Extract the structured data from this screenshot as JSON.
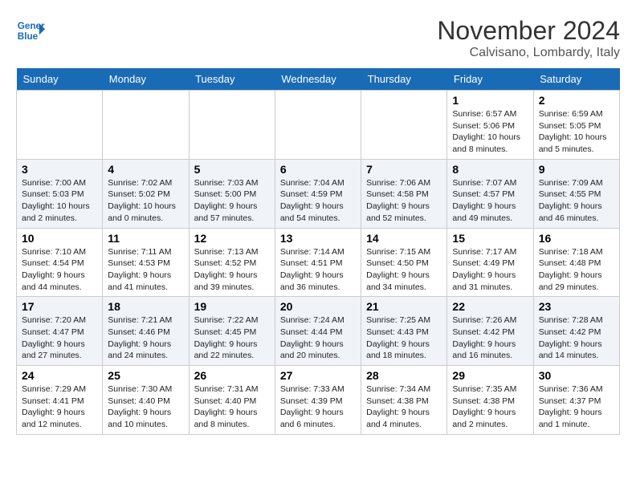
{
  "header": {
    "logo_line1": "General",
    "logo_line2": "Blue",
    "month": "November 2024",
    "location": "Calvisano, Lombardy, Italy"
  },
  "weekdays": [
    "Sunday",
    "Monday",
    "Tuesday",
    "Wednesday",
    "Thursday",
    "Friday",
    "Saturday"
  ],
  "weeks": [
    [
      {
        "day": "",
        "info": ""
      },
      {
        "day": "",
        "info": ""
      },
      {
        "day": "",
        "info": ""
      },
      {
        "day": "",
        "info": ""
      },
      {
        "day": "",
        "info": ""
      },
      {
        "day": "1",
        "info": "Sunrise: 6:57 AM\nSunset: 5:06 PM\nDaylight: 10 hours\nand 8 minutes."
      },
      {
        "day": "2",
        "info": "Sunrise: 6:59 AM\nSunset: 5:05 PM\nDaylight: 10 hours\nand 5 minutes."
      }
    ],
    [
      {
        "day": "3",
        "info": "Sunrise: 7:00 AM\nSunset: 5:03 PM\nDaylight: 10 hours\nand 2 minutes."
      },
      {
        "day": "4",
        "info": "Sunrise: 7:02 AM\nSunset: 5:02 PM\nDaylight: 10 hours\nand 0 minutes."
      },
      {
        "day": "5",
        "info": "Sunrise: 7:03 AM\nSunset: 5:00 PM\nDaylight: 9 hours\nand 57 minutes."
      },
      {
        "day": "6",
        "info": "Sunrise: 7:04 AM\nSunset: 4:59 PM\nDaylight: 9 hours\nand 54 minutes."
      },
      {
        "day": "7",
        "info": "Sunrise: 7:06 AM\nSunset: 4:58 PM\nDaylight: 9 hours\nand 52 minutes."
      },
      {
        "day": "8",
        "info": "Sunrise: 7:07 AM\nSunset: 4:57 PM\nDaylight: 9 hours\nand 49 minutes."
      },
      {
        "day": "9",
        "info": "Sunrise: 7:09 AM\nSunset: 4:55 PM\nDaylight: 9 hours\nand 46 minutes."
      }
    ],
    [
      {
        "day": "10",
        "info": "Sunrise: 7:10 AM\nSunset: 4:54 PM\nDaylight: 9 hours\nand 44 minutes."
      },
      {
        "day": "11",
        "info": "Sunrise: 7:11 AM\nSunset: 4:53 PM\nDaylight: 9 hours\nand 41 minutes."
      },
      {
        "day": "12",
        "info": "Sunrise: 7:13 AM\nSunset: 4:52 PM\nDaylight: 9 hours\nand 39 minutes."
      },
      {
        "day": "13",
        "info": "Sunrise: 7:14 AM\nSunset: 4:51 PM\nDaylight: 9 hours\nand 36 minutes."
      },
      {
        "day": "14",
        "info": "Sunrise: 7:15 AM\nSunset: 4:50 PM\nDaylight: 9 hours\nand 34 minutes."
      },
      {
        "day": "15",
        "info": "Sunrise: 7:17 AM\nSunset: 4:49 PM\nDaylight: 9 hours\nand 31 minutes."
      },
      {
        "day": "16",
        "info": "Sunrise: 7:18 AM\nSunset: 4:48 PM\nDaylight: 9 hours\nand 29 minutes."
      }
    ],
    [
      {
        "day": "17",
        "info": "Sunrise: 7:20 AM\nSunset: 4:47 PM\nDaylight: 9 hours\nand 27 minutes."
      },
      {
        "day": "18",
        "info": "Sunrise: 7:21 AM\nSunset: 4:46 PM\nDaylight: 9 hours\nand 24 minutes."
      },
      {
        "day": "19",
        "info": "Sunrise: 7:22 AM\nSunset: 4:45 PM\nDaylight: 9 hours\nand 22 minutes."
      },
      {
        "day": "20",
        "info": "Sunrise: 7:24 AM\nSunset: 4:44 PM\nDaylight: 9 hours\nand 20 minutes."
      },
      {
        "day": "21",
        "info": "Sunrise: 7:25 AM\nSunset: 4:43 PM\nDaylight: 9 hours\nand 18 minutes."
      },
      {
        "day": "22",
        "info": "Sunrise: 7:26 AM\nSunset: 4:42 PM\nDaylight: 9 hours\nand 16 minutes."
      },
      {
        "day": "23",
        "info": "Sunrise: 7:28 AM\nSunset: 4:42 PM\nDaylight: 9 hours\nand 14 minutes."
      }
    ],
    [
      {
        "day": "24",
        "info": "Sunrise: 7:29 AM\nSunset: 4:41 PM\nDaylight: 9 hours\nand 12 minutes."
      },
      {
        "day": "25",
        "info": "Sunrise: 7:30 AM\nSunset: 4:40 PM\nDaylight: 9 hours\nand 10 minutes."
      },
      {
        "day": "26",
        "info": "Sunrise: 7:31 AM\nSunset: 4:40 PM\nDaylight: 9 hours\nand 8 minutes."
      },
      {
        "day": "27",
        "info": "Sunrise: 7:33 AM\nSunset: 4:39 PM\nDaylight: 9 hours\nand 6 minutes."
      },
      {
        "day": "28",
        "info": "Sunrise: 7:34 AM\nSunset: 4:38 PM\nDaylight: 9 hours\nand 4 minutes."
      },
      {
        "day": "29",
        "info": "Sunrise: 7:35 AM\nSunset: 4:38 PM\nDaylight: 9 hours\nand 2 minutes."
      },
      {
        "day": "30",
        "info": "Sunrise: 7:36 AM\nSunset: 4:37 PM\nDaylight: 9 hours\nand 1 minute."
      }
    ]
  ]
}
